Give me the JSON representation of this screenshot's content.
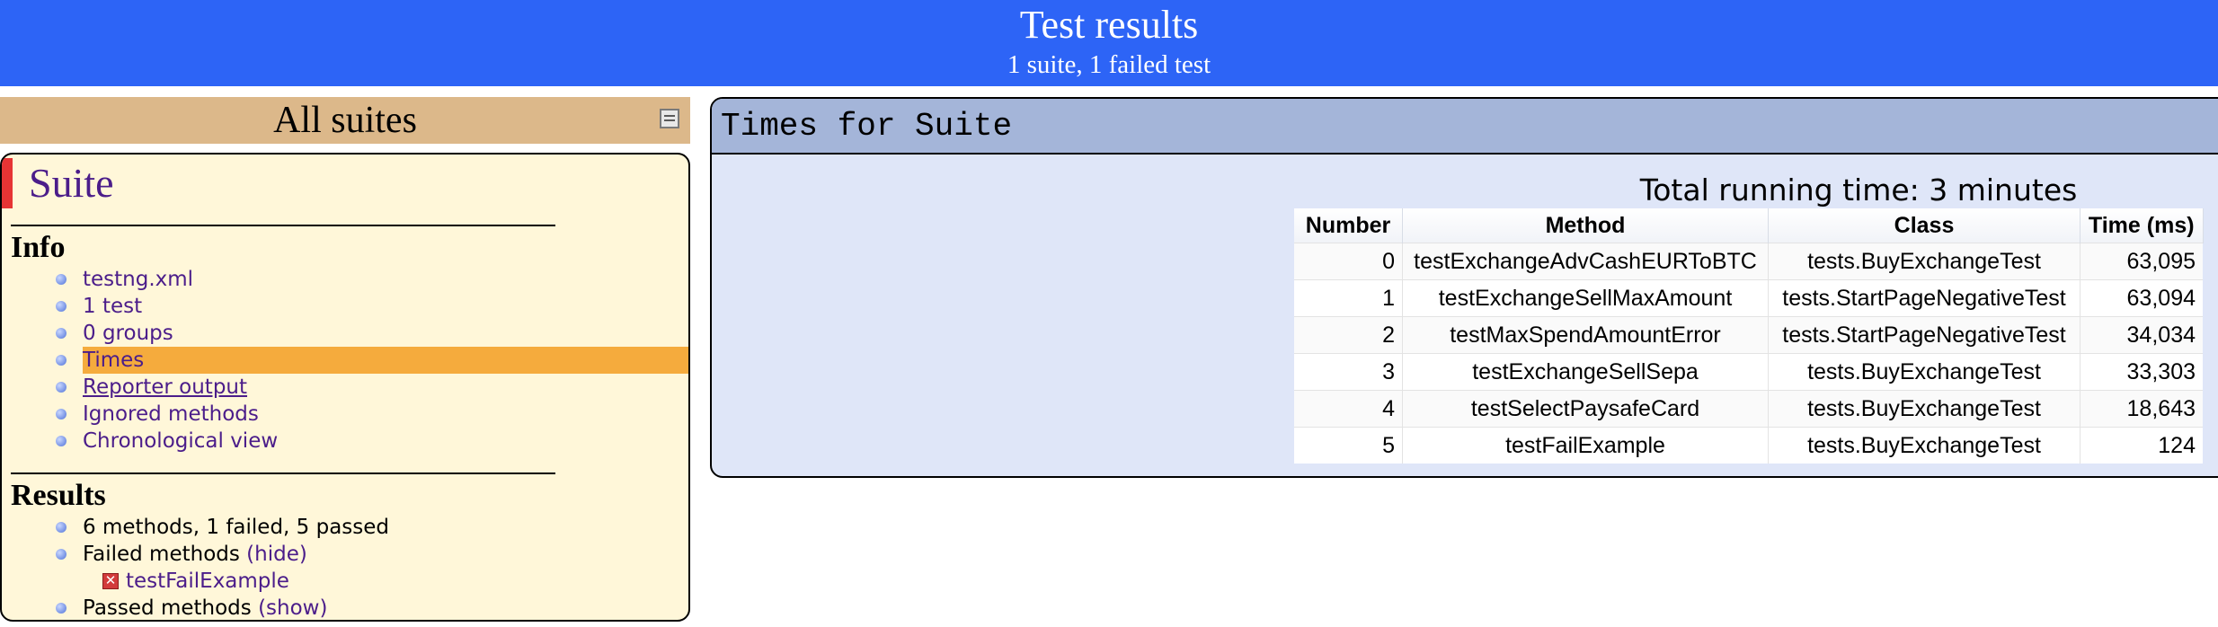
{
  "header": {
    "title": "Test results",
    "subtitle": "1 suite, 1 failed test"
  },
  "navigator": {
    "title": "All suites",
    "collapse_icon": "collapse-icon",
    "suite_name": "Suite",
    "info_heading": "Info",
    "info_items": [
      {
        "label": "testng.xml"
      },
      {
        "label": "1 test"
      },
      {
        "label": "0 groups"
      },
      {
        "label": "Times",
        "selected": true
      },
      {
        "label": "Reporter output"
      },
      {
        "label": "Ignored methods"
      },
      {
        "label": "Chronological view"
      }
    ],
    "results_heading": "Results",
    "results": {
      "summary": "6 methods, 1 failed, 5 passed",
      "failed_label": "Failed methods",
      "failed_toggle": "(hide)",
      "failed_method": "testFailExample",
      "passed_label": "Passed methods",
      "passed_toggle": "(show)"
    }
  },
  "times": {
    "panel_title": "Times for Suite",
    "total_running_time": "Total running time: 3 minutes",
    "columns": [
      "Number",
      "Method",
      "Class",
      "Time (ms)"
    ],
    "rows": [
      {
        "number": "0",
        "method": "testExchangeAdvCashEURToBTC",
        "class": "tests.BuyExchangeTest",
        "time": "63,095"
      },
      {
        "number": "1",
        "method": "testExchangeSellMaxAmount",
        "class": "tests.StartPageNegativeTest",
        "time": "63,094"
      },
      {
        "number": "2",
        "method": "testMaxSpendAmountError",
        "class": "tests.StartPageNegativeTest",
        "time": "34,034"
      },
      {
        "number": "3",
        "method": "testExchangeSellSepa",
        "class": "tests.BuyExchangeTest",
        "time": "33,303"
      },
      {
        "number": "4",
        "method": "testSelectPaysafeCard",
        "class": "tests.BuyExchangeTest",
        "time": "18,643"
      },
      {
        "number": "5",
        "method": "testFailExample",
        "class": "tests.BuyExchangeTest",
        "time": "124"
      }
    ]
  },
  "colors": {
    "banner": "#2d64f6",
    "nav_header": "#dcb88a",
    "suite_panel": "#fff7d9",
    "selected_item": "#f5ab3d",
    "link": "#4b1d8a",
    "times_header": "#a4b5d9",
    "times_panel": "#dfe6f8",
    "failed_flag": "#e63434"
  }
}
